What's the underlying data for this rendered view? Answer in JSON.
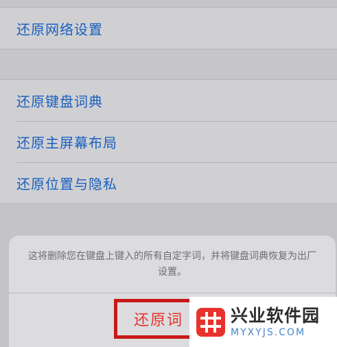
{
  "settings": {
    "network_reset": "还原网络设置",
    "group_items": [
      {
        "label": "还原键盘词典"
      },
      {
        "label": "还原主屏幕布局"
      },
      {
        "label": "还原位置与隐私"
      }
    ]
  },
  "action_sheet": {
    "message": "这将删除您在键盘上键入的所有自定字词，并将键盘词典恢复为出厂设置。",
    "confirm_label": "还原词"
  },
  "watermark": {
    "name": "兴业软件园",
    "domain": "MYXYJS.COM"
  },
  "colors": {
    "link_blue": "#1a5fbf",
    "destructive_red": "#e8322d",
    "highlight_border": "#c81818",
    "logo_red": "#e8322d"
  }
}
